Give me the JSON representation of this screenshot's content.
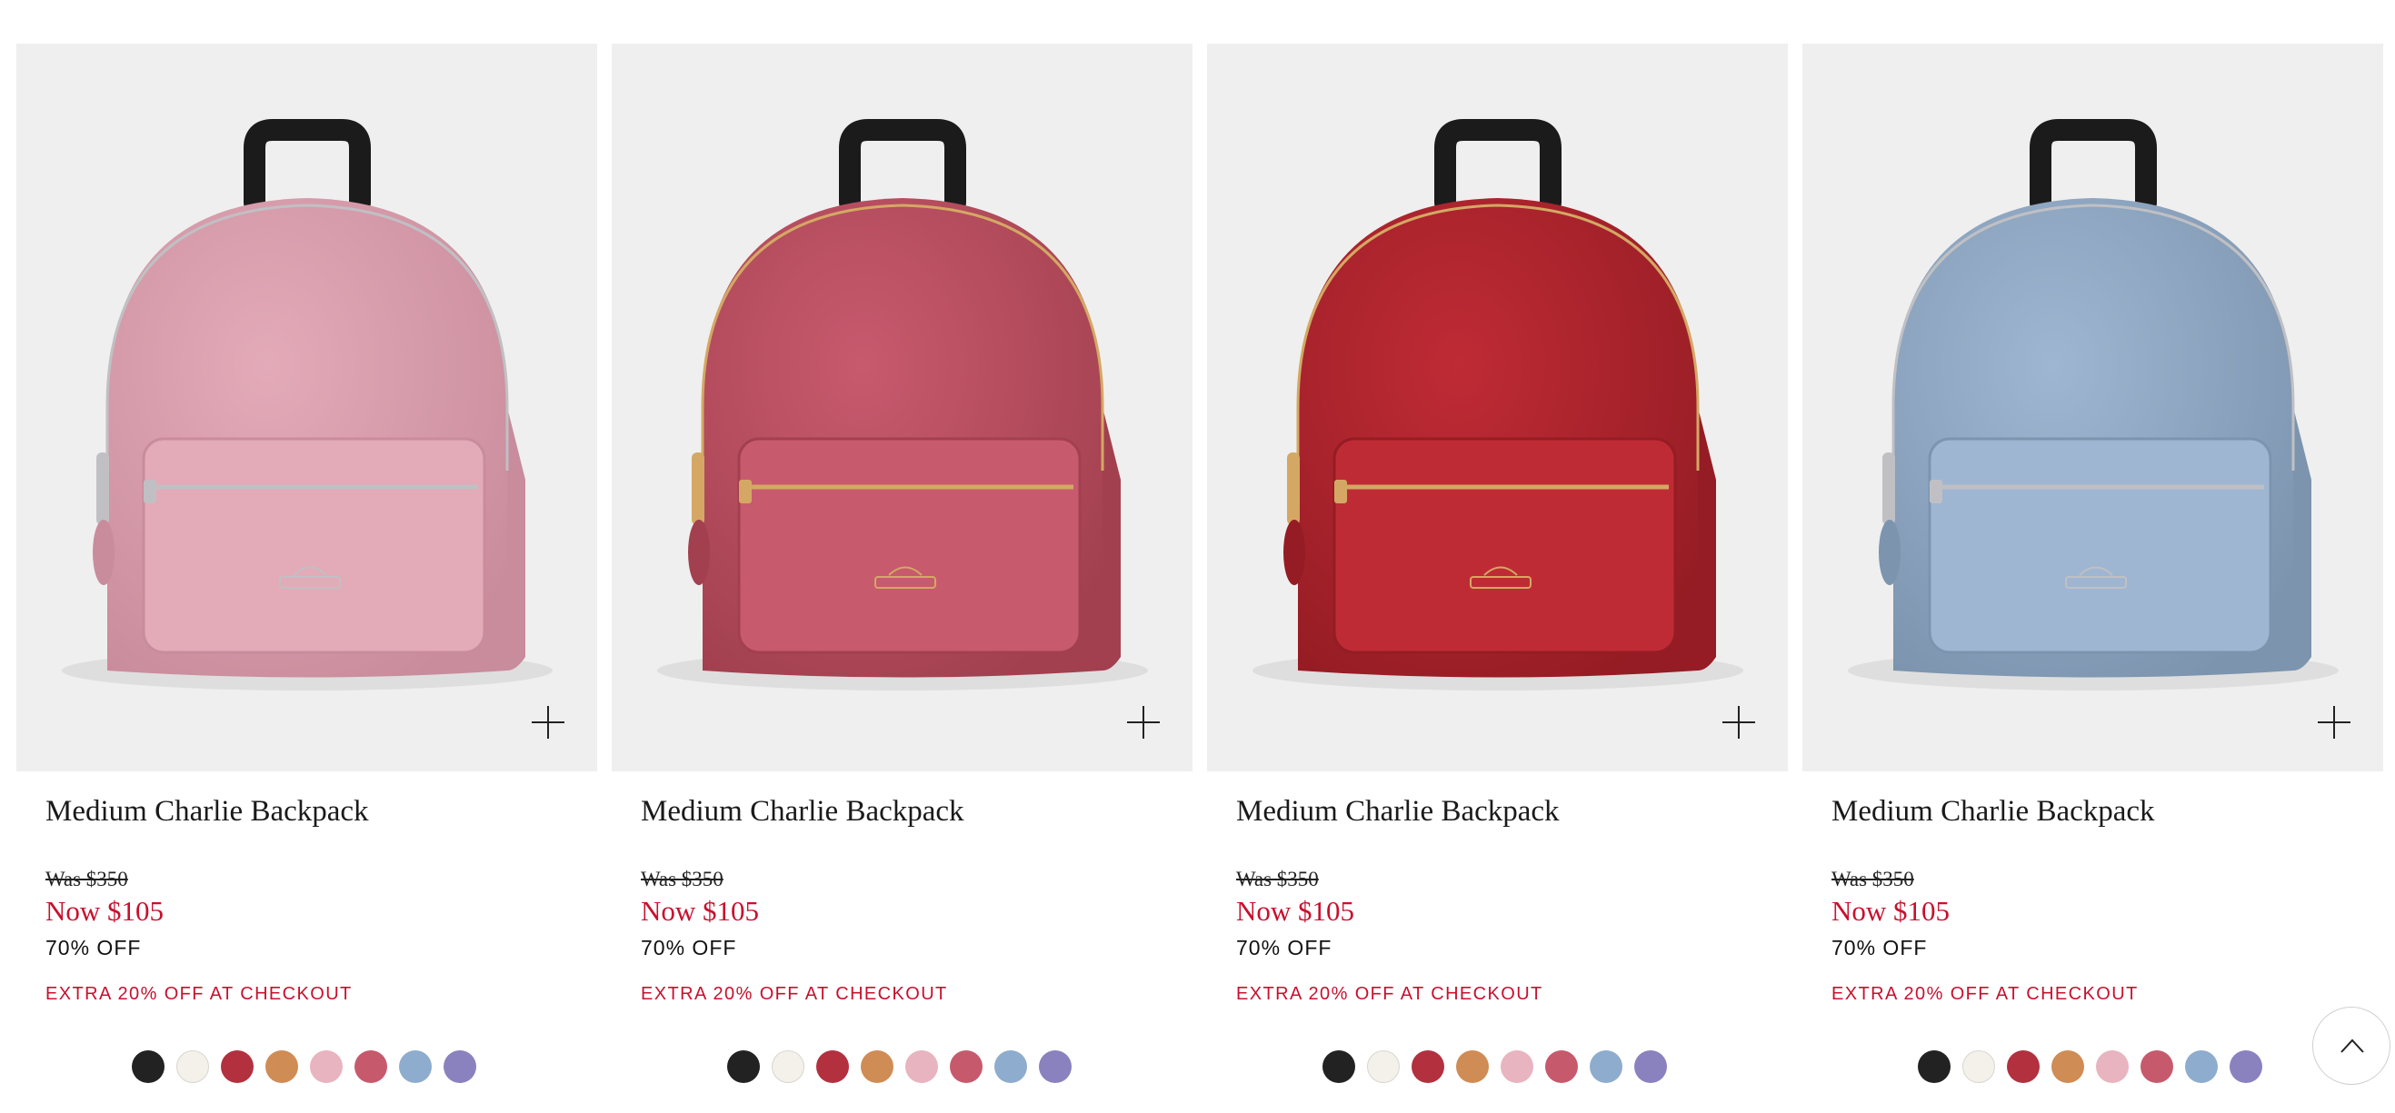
{
  "products": [
    {
      "name": "Medium Charlie Backpack",
      "was_price": "Was $350",
      "now_price": "Now $105",
      "discount": "70% OFF",
      "promo": "EXTRA 20% OFF AT CHECKOUT",
      "bag_color": "#e3aab8",
      "bag_shade": "#c98c9c",
      "hardware": "#c0c0c4"
    },
    {
      "name": "Medium Charlie Backpack",
      "was_price": "Was $350",
      "now_price": "Now $105",
      "discount": "70% OFF",
      "promo": "EXTRA 20% OFF AT CHECKOUT",
      "bag_color": "#c85a6e",
      "bag_shade": "#a2404f",
      "hardware": "#d4a864"
    },
    {
      "name": "Medium Charlie Backpack",
      "was_price": "Was $350",
      "now_price": "Now $105",
      "discount": "70% OFF",
      "promo": "EXTRA 20% OFF AT CHECKOUT",
      "bag_color": "#bf2b35",
      "bag_shade": "#951c24",
      "hardware": "#d4a864"
    },
    {
      "name": "Medium Charlie Backpack",
      "was_price": "Was $350",
      "now_price": "Now $105",
      "discount": "70% OFF",
      "promo": "EXTRA 20% OFF AT CHECKOUT",
      "bag_color": "#9eb6d1",
      "bag_shade": "#7c94ae",
      "hardware": "#c0c0c4"
    }
  ],
  "swatch_colors": [
    "#222222",
    "#f4f1ea",
    "#b3303f",
    "#d08c55",
    "#e8b4c0",
    "#c65a6c",
    "#8eaccd",
    "#8a82bf"
  ],
  "colors": {
    "sale_red": "#c8102e",
    "image_background": "#efefef",
    "strap": "#1b1b1b"
  },
  "icons": {
    "quick_add": "plus-icon",
    "scroll_top": "chevron-up-icon"
  }
}
